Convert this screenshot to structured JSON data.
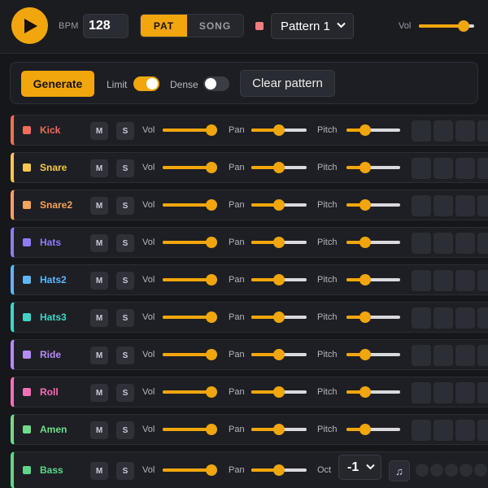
{
  "topbar": {
    "play_icon": "play-icon",
    "bpm_label": "BPM",
    "bpm_value": "128",
    "modes": [
      "PAT",
      "SONG"
    ],
    "active_mode": "PAT",
    "pattern_color": "#f27d7d",
    "pattern_selected": "Pattern 1",
    "vol_label": "Vol",
    "master_volume": 0.81
  },
  "generator": {
    "generate_label": "Generate",
    "limit_label": "Limit",
    "limit_on": true,
    "dense_label": "Dense",
    "dense_on": false,
    "clear_label": "Clear pattern"
  },
  "track_labels": {
    "mute": "M",
    "solo": "S",
    "vol": "Vol",
    "pan": "Pan",
    "pitch": "Pitch",
    "oct": "Oct"
  },
  "tracks": [
    {
      "name": "Kick",
      "color": "#f26d5b",
      "vol": 0.92,
      "pan": 0.5,
      "pitch": 0.35
    },
    {
      "name": "Snare",
      "color": "#f5c84a",
      "vol": 0.92,
      "pan": 0.5,
      "pitch": 0.35
    },
    {
      "name": "Snare2",
      "color": "#f5a35a",
      "vol": 0.92,
      "pan": 0.5,
      "pitch": 0.35
    },
    {
      "name": "Hats",
      "color": "#8f7cf5",
      "vol": 0.92,
      "pan": 0.5,
      "pitch": 0.35
    },
    {
      "name": "Hats2",
      "color": "#5fb6f5",
      "vol": 0.92,
      "pan": 0.5,
      "pitch": 0.35
    },
    {
      "name": "Hats3",
      "color": "#3fd5c6",
      "vol": 0.92,
      "pan": 0.5,
      "pitch": 0.35
    },
    {
      "name": "Ride",
      "color": "#b48cf5",
      "vol": 0.92,
      "pan": 0.5,
      "pitch": 0.35
    },
    {
      "name": "Roll",
      "color": "#f56fb4",
      "vol": 0.92,
      "pan": 0.5,
      "pitch": 0.35
    },
    {
      "name": "Amen",
      "color": "#6fdc8c",
      "vol": 0.92,
      "pan": 0.5,
      "pitch": 0.35
    },
    {
      "name": "Bass",
      "color": "#5fd68a",
      "vol": 0.92,
      "pan": 0.5,
      "octave": "-1",
      "note_icon": "music-note-icon"
    }
  ]
}
